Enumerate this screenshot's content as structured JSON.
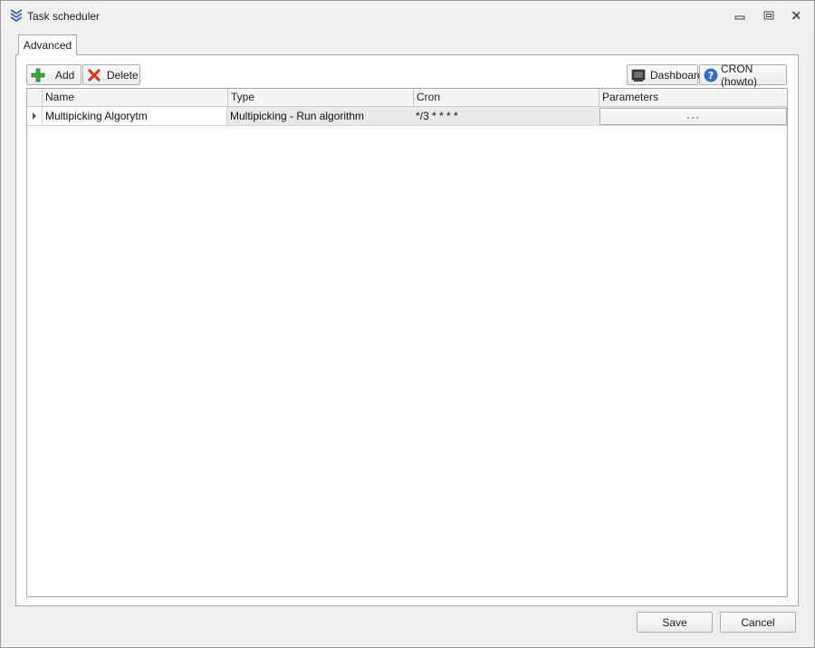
{
  "window": {
    "title": "Task scheduler"
  },
  "tabs": [
    {
      "label": "Advanced",
      "active": true
    }
  ],
  "toolbar": {
    "add_label": "Add",
    "delete_label": "Delete",
    "dashboard_label": "Dashboard",
    "cron_help_label": "CRON (howto)"
  },
  "grid": {
    "columns": [
      "Name",
      "Type",
      "Cron",
      "Parameters"
    ],
    "rows": [
      {
        "name": "Multipicking Algorytm",
        "type": "Multipicking - Run algorithm",
        "cron": "*/3 * * * *",
        "parameters_button": "···"
      }
    ]
  },
  "footer": {
    "save_label": "Save",
    "cancel_label": "Cancel"
  },
  "colors": {
    "add_icon": "#3aa83a",
    "delete_icon": "#d33b2c",
    "help_icon": "#2f6fc8",
    "app_icon": "#3b66b0"
  },
  "icons": {
    "app": "stacked-chevrons-icon",
    "add": "plus-icon",
    "delete": "x-icon",
    "dashboard": "monitor-icon",
    "cron_help": "question-icon"
  }
}
